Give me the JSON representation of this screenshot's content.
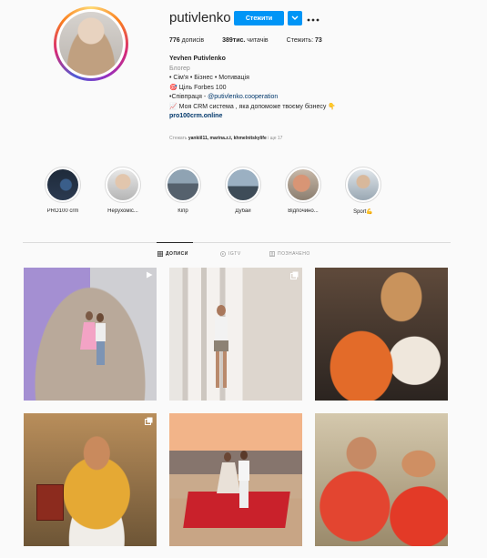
{
  "profile": {
    "username": "putivlenko",
    "follow_label": "Стежити",
    "stats": {
      "posts_count": "776",
      "posts_label": "дописів",
      "followers_count": "389тис.",
      "followers_label": "читачів",
      "following_prefix": "Стежить:",
      "following_count": "73"
    },
    "bio": {
      "full_name": "Yevhen Putivlenko",
      "category": "Блогер",
      "line1": "• Сім'я • Бізнес • Мотивація",
      "line2": "🎯 Ціль Forbes 100",
      "line3_prefix": "•Співпраця - ",
      "line3_mention": "@putivlenko.cooperation",
      "line4": "📈 Моя CRM система , яка допоможе твоєму бізнесу 👇",
      "website": "pro100crm.online"
    },
    "followed_by": {
      "prefix": "Стежать ",
      "names": "yankiil11, marina.z.t, khmelnitskylife",
      "suffix": " і ще 17"
    }
  },
  "highlights": [
    {
      "label": "PRO100 crm"
    },
    {
      "label": "Нерухоміс..."
    },
    {
      "label": "Кіпр"
    },
    {
      "label": "Дубай"
    },
    {
      "label": "Відпочинo..."
    },
    {
      "label": "Sport💪"
    }
  ],
  "tabs": [
    {
      "label": "ДОПИСИ",
      "icon": "grid-icon"
    },
    {
      "label": "IGTV",
      "icon": "igtv-icon"
    },
    {
      "label": "ПОЗНАЧЕНО",
      "icon": "tagged-icon"
    }
  ],
  "posts": [
    {
      "overlay_icon": "video-icon"
    },
    {
      "overlay_icon": "carousel-icon"
    },
    {
      "overlay_icon": null
    },
    {
      "overlay_icon": "carousel-icon"
    },
    {
      "overlay_icon": null
    },
    {
      "overlay_icon": null
    }
  ],
  "colors": {
    "accent": "#0095f6",
    "text": "#262626",
    "muted": "#8e8e8e",
    "link": "#00376b"
  }
}
